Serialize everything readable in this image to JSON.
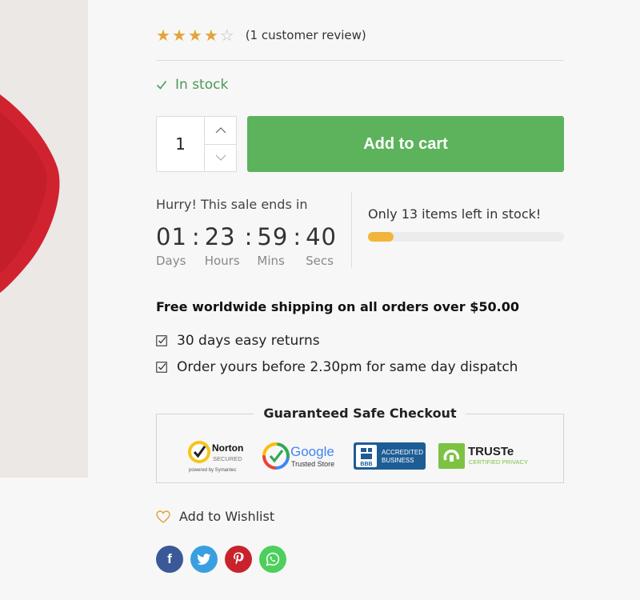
{
  "rating": {
    "stars_filled": 4,
    "stars_total": 5,
    "review_text": "(1 customer review)"
  },
  "stock": {
    "status": "In stock",
    "left_text": "Only 13 items left in stock!",
    "progress_fraction": 0.13
  },
  "cart": {
    "quantity": "1",
    "add_label": "Add to cart"
  },
  "countdown": {
    "heading": "Hurry! This sale ends in",
    "days": "01",
    "hours": "23",
    "mins": "59",
    "secs": "40",
    "days_label": "Days",
    "hours_label": "Hours",
    "mins_label": "Mins",
    "secs_label": "Secs",
    "separator": ":"
  },
  "shipping": {
    "headline": "Free worldwide shipping on all orders over $50.00",
    "bullets": [
      "30 days easy returns",
      "Order yours before 2.30pm for same day dispatch"
    ]
  },
  "checkout": {
    "title": "Guaranteed Safe Checkout",
    "badges": {
      "norton": {
        "name": "Norton",
        "sub": "SECURED",
        "by": "powered by Symantec"
      },
      "google": {
        "name": "Google",
        "sub": "Trusted Store"
      },
      "bbb": {
        "mark": "BBB",
        "line1": "ACCREDITED",
        "line2": "BUSINESS"
      },
      "truste": {
        "name": "TRUSTe",
        "sub": "CERTIFIED PRIVACY"
      }
    }
  },
  "wishlist": {
    "label": "Add to Wishlist"
  },
  "social": {
    "facebook_glyph": "f",
    "colors": {
      "facebook": "#3b5998",
      "twitter": "#3a9fe0",
      "pinterest": "#c8232c",
      "whatsapp": "#4ccf5c"
    }
  },
  "colors": {
    "accent_green": "#5cb35c",
    "star": "#e3a43a",
    "in_stock": "#4a9a58",
    "progress": "#f2b53a"
  }
}
